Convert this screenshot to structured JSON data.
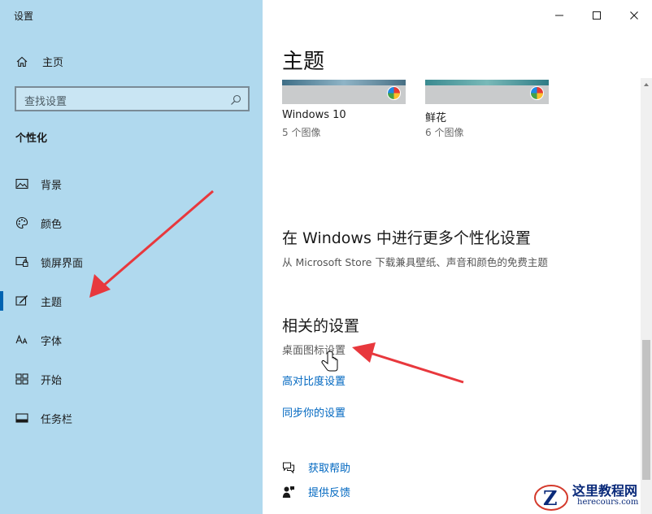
{
  "window": {
    "title": "设置"
  },
  "sidebar": {
    "home_label": "主页",
    "search_placeholder": "查找设置",
    "section_title": "个性化",
    "items": [
      {
        "label": "背景",
        "icon": "picture-icon"
      },
      {
        "label": "颜色",
        "icon": "palette-icon"
      },
      {
        "label": "锁屏界面",
        "icon": "lock-screen-icon"
      },
      {
        "label": "主题",
        "icon": "theme-brush-icon",
        "active": true
      },
      {
        "label": "字体",
        "icon": "font-icon"
      },
      {
        "label": "开始",
        "icon": "start-grid-icon"
      },
      {
        "label": "任务栏",
        "icon": "taskbar-icon"
      }
    ]
  },
  "main": {
    "title": "主题",
    "themes": [
      {
        "name": "Windows 10",
        "count": "5 个图像"
      },
      {
        "name": "鲜花",
        "count": "6 个图像"
      }
    ],
    "more_section": {
      "heading": "在 Windows 中进行更多个性化设置",
      "description": "从 Microsoft Store 下载兼具壁纸、声音和颜色的免费主题"
    },
    "related": {
      "heading": "相关的设置",
      "links": [
        "桌面图标设置",
        "高对比度设置",
        "同步你的设置"
      ]
    },
    "help": {
      "get_help": "获取帮助",
      "feedback": "提供反馈"
    }
  },
  "colors": {
    "sidebar_bg": "#b0d9ee",
    "accent": "#0063b1",
    "link": "#0067c0",
    "arrow": "#e8383d"
  },
  "watermark": {
    "name": "这里教程网",
    "url": "herecours.com"
  }
}
